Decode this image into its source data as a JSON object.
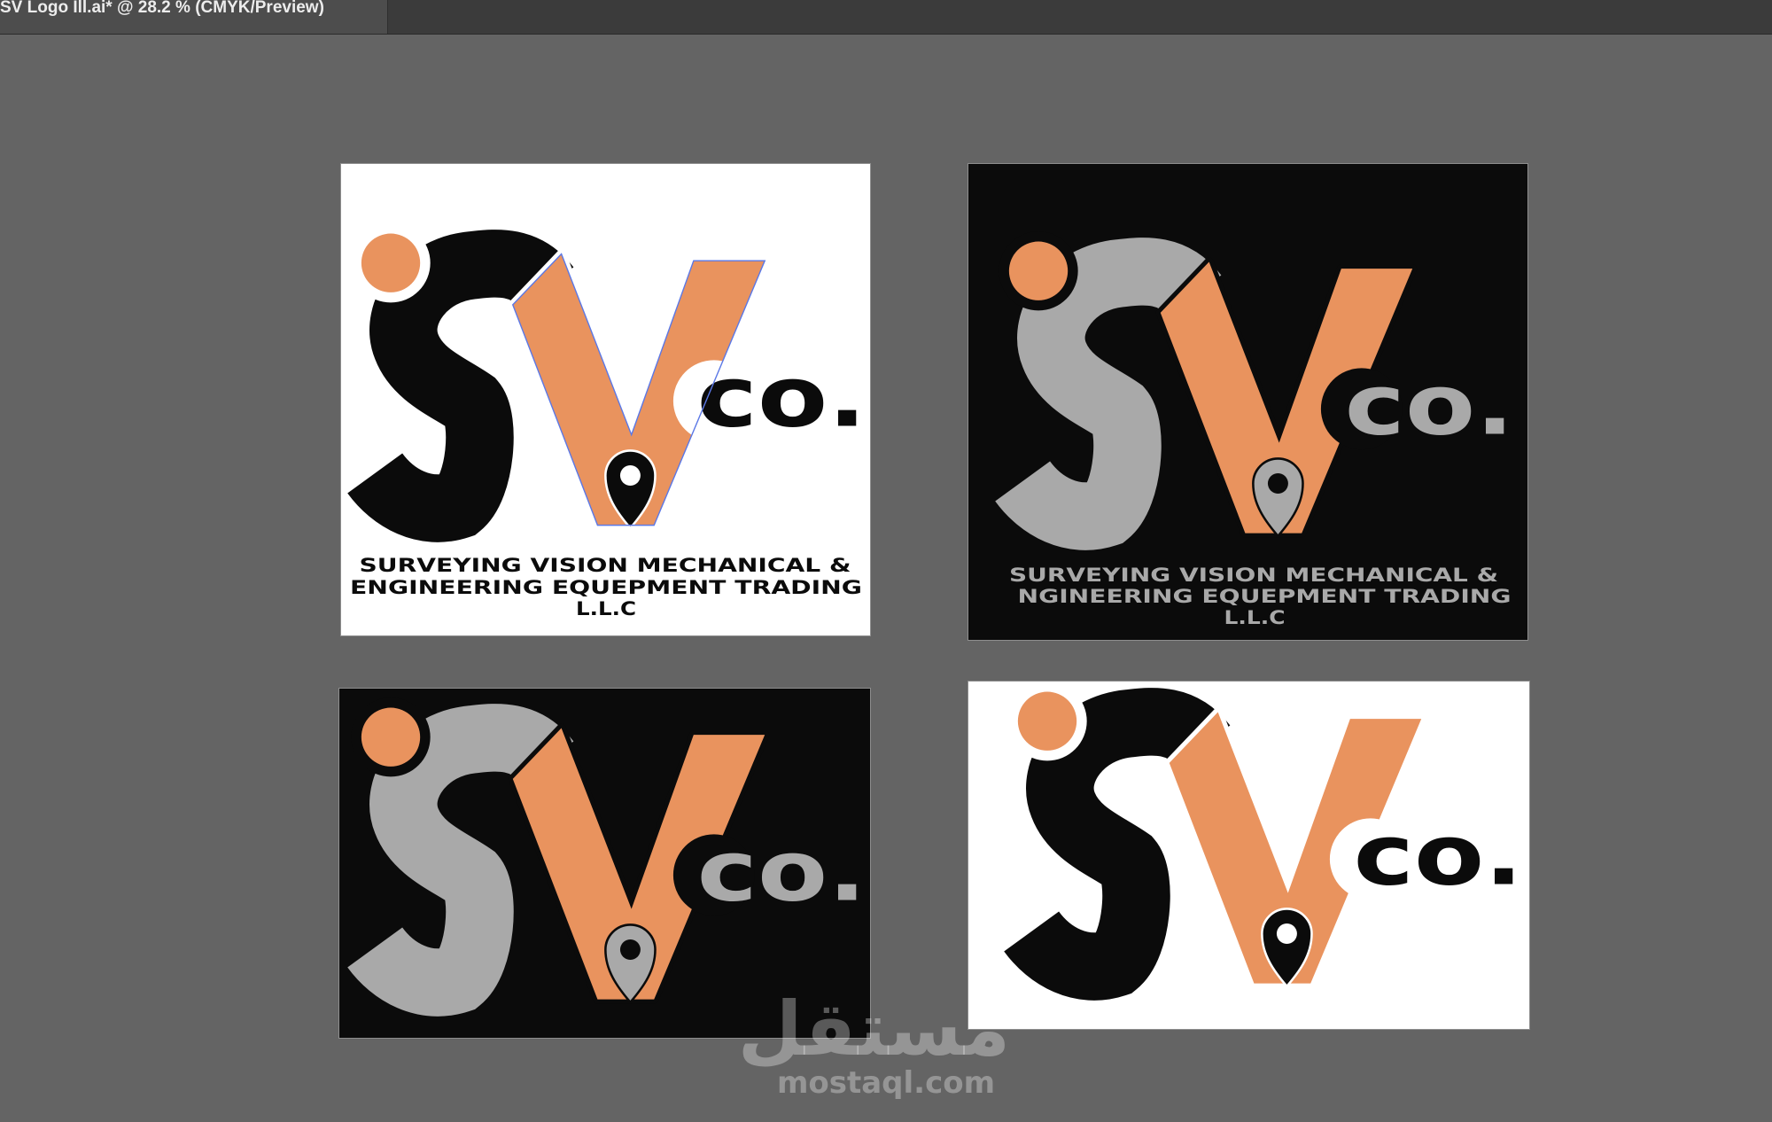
{
  "document_tab": {
    "title": "SV Logo Ill.ai* @ 28.2 % (CMYK/Preview)"
  },
  "ui_colors": {
    "tab_bar": "#3b3b3b",
    "tab": "#4d4d4d",
    "tab_text": "#ececec",
    "canvas": "#646464"
  },
  "logo": {
    "mark_letters": "SV",
    "pin_icon": "map-pin"
  },
  "artboards": [
    {
      "background": "#ffffff",
      "letter_color": "#0b0b0b",
      "accent_color": "#e9935e",
      "pin_color": "#0b0b0b",
      "suffix": "co.",
      "tagline": [
        "SURVEYING VISION MECHANICAL &",
        "ENGINEERING EQUEPMENT TRADING",
        "L.L.C"
      ],
      "selected": true,
      "selection_color": "#5b78e6"
    },
    {
      "background": "#0b0b0b",
      "letter_color": "#a9a9a9",
      "accent_color": "#e9935e",
      "pin_color": "#a9a9a9",
      "suffix": "co.",
      "tagline": [
        "SURVEYING VISION MECHANICAL &",
        "NGINEERING EQUEPMENT TRADING",
        "L.L.C"
      ]
    },
    {
      "background": "#0b0b0b",
      "letter_color": "#a9a9a9",
      "accent_color": "#e9935e",
      "pin_color": "#a9a9a9",
      "suffix": "co."
    },
    {
      "background": "#ffffff",
      "letter_color": "#0b0b0b",
      "accent_color": "#e9935e",
      "pin_color": "#0b0b0b",
      "suffix": "co."
    }
  ],
  "watermark": {
    "arabic": "مستقل",
    "latin": "mostaql.com",
    "color": "rgba(255,255,255,0.32)"
  }
}
